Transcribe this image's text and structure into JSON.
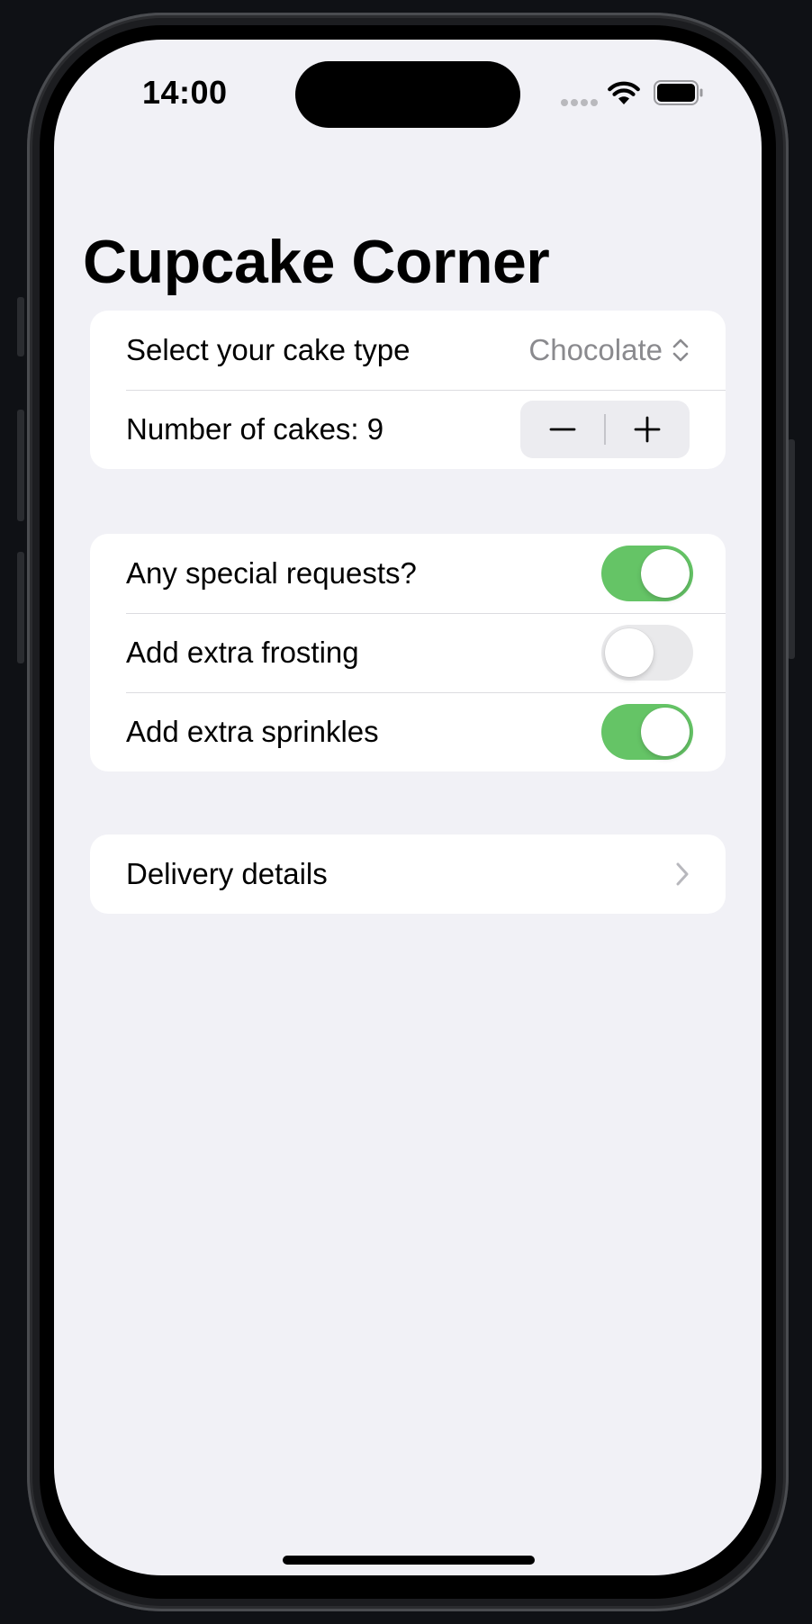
{
  "status_bar": {
    "time": "14:00",
    "icons": [
      "signal-dots-icon",
      "wifi-icon",
      "battery-icon"
    ]
  },
  "nav": {
    "title": "Cupcake Corner"
  },
  "order_section": {
    "cake_type_label": "Select your cake type",
    "cake_type_value": "Chocolate",
    "quantity_label": "Number of cakes: 9",
    "quantity": 9
  },
  "extras_section": {
    "special_requests": {
      "label": "Any special requests?",
      "on": true
    },
    "extra_frosting": {
      "label": "Add extra frosting",
      "on": false
    },
    "extra_sprinkles": {
      "label": "Add extra sprinkles",
      "on": true
    }
  },
  "delivery_section": {
    "label": "Delivery details"
  },
  "colors": {
    "accent_toggle_on": "#65c466",
    "toggle_off": "#e9e9eb",
    "background": "#f1f1f6",
    "secondary_text": "#8a8a8e"
  }
}
